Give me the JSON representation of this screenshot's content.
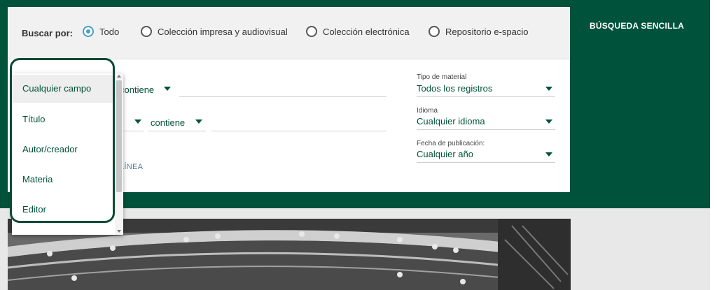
{
  "header": {
    "simple_search": "BÚSQUEDA SENCILLA"
  },
  "scope": {
    "label": "Buscar por:",
    "options": [
      {
        "label": "Todo",
        "selected": true
      },
      {
        "label": "Colección impresa y audiovisual",
        "selected": false
      },
      {
        "label": "Colección electrónica",
        "selected": false
      },
      {
        "label": "Repositorio e-spacio",
        "selected": false
      }
    ]
  },
  "query": {
    "row1": {
      "operator": "contiene",
      "value": ""
    },
    "row2": {
      "operator": "contiene",
      "value": ""
    },
    "add_line": "LÍNEA"
  },
  "filters": {
    "material": {
      "label": "Tipo de material",
      "value": "Todos los registros"
    },
    "language": {
      "label": "Idioma",
      "value": "Cualquier idioma"
    },
    "date": {
      "label": "Fecha de publicación:",
      "value": "Cualquier año"
    }
  },
  "field_dropdown": {
    "options": [
      {
        "label": "Cualquier campo",
        "active": true
      },
      {
        "label": "Título",
        "active": false
      },
      {
        "label": "Autor/creador",
        "active": false
      },
      {
        "label": "Materia",
        "active": false
      },
      {
        "label": "Editor",
        "active": false
      }
    ]
  },
  "colors": {
    "brand_green": "#00523a",
    "radio_accent": "#4aa0c0",
    "link_blue": "#4a7fa0"
  }
}
